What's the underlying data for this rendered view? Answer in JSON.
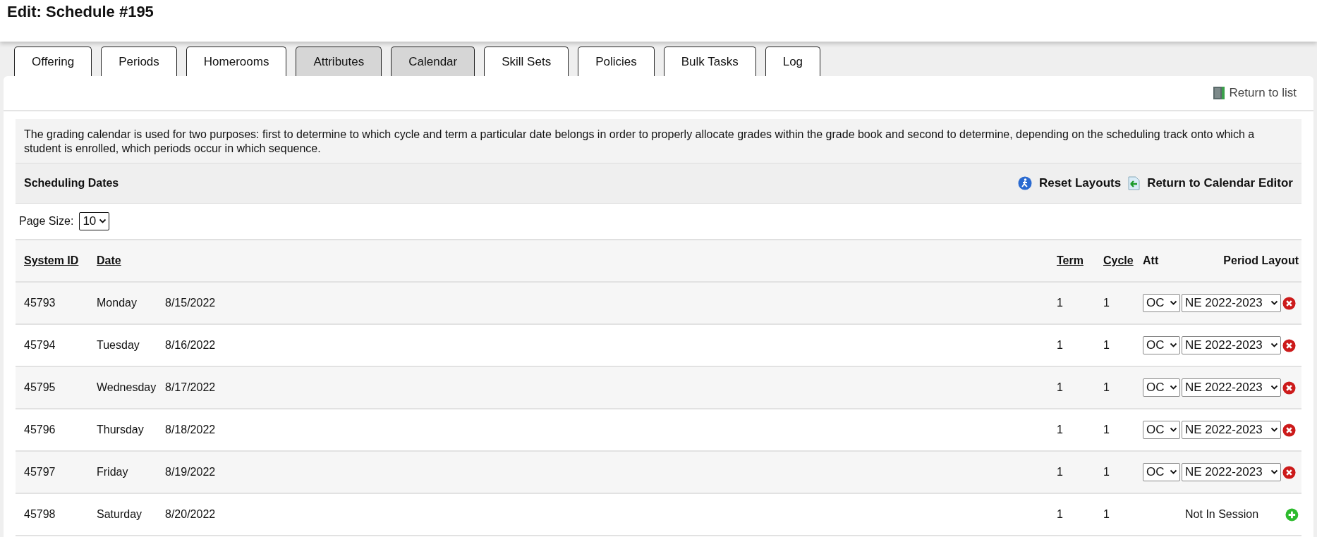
{
  "page_title": "Edit: Schedule #195",
  "tabs": [
    {
      "label": "Offering",
      "shaded": false
    },
    {
      "label": "Periods",
      "shaded": false
    },
    {
      "label": "Homerooms",
      "shaded": false
    },
    {
      "label": "Attributes",
      "shaded": true
    },
    {
      "label": "Calendar",
      "shaded": true
    },
    {
      "label": "Skill Sets",
      "shaded": false
    },
    {
      "label": "Policies",
      "shaded": false
    },
    {
      "label": "Bulk Tasks",
      "shaded": false
    },
    {
      "label": "Log",
      "shaded": false
    }
  ],
  "return_link": "Return to list",
  "description": "The grading calendar is used for two purposes: first to determine to which cycle and term a particular date belongs in order to properly allocate grades within the grade book and second to determine, depending on the scheduling track onto which a student is enrolled, which periods occur in which sequence.",
  "section": {
    "title": "Scheduling Dates",
    "actions": [
      {
        "kind": "reset",
        "label": "Reset Layouts"
      },
      {
        "kind": "back",
        "label": "Return to Calendar Editor"
      }
    ]
  },
  "page_size": {
    "label": "Page Size:",
    "value": "10"
  },
  "table": {
    "columns": [
      {
        "label": "System ID",
        "sortable": true
      },
      {
        "label": "Date",
        "sortable": true
      },
      {
        "label": "Term",
        "sortable": true
      },
      {
        "label": "Cycle",
        "sortable": true
      },
      {
        "label": "Att",
        "sortable": false
      },
      {
        "label": "Period Layout",
        "sortable": false
      }
    ],
    "rows": [
      {
        "system_id": "45793",
        "day": "Monday",
        "date": "8/15/2022",
        "term": "1",
        "cycle": "1",
        "kind": "in_session",
        "att": "OC",
        "period_layout": "NE 2022-2023"
      },
      {
        "system_id": "45794",
        "day": "Tuesday",
        "date": "8/16/2022",
        "term": "1",
        "cycle": "1",
        "kind": "in_session",
        "att": "OC",
        "period_layout": "NE 2022-2023"
      },
      {
        "system_id": "45795",
        "day": "Wednesday",
        "date": "8/17/2022",
        "term": "1",
        "cycle": "1",
        "kind": "in_session",
        "att": "OC",
        "period_layout": "NE 2022-2023"
      },
      {
        "system_id": "45796",
        "day": "Thursday",
        "date": "8/18/2022",
        "term": "1",
        "cycle": "1",
        "kind": "in_session",
        "att": "OC",
        "period_layout": "NE 2022-2023"
      },
      {
        "system_id": "45797",
        "day": "Friday",
        "date": "8/19/2022",
        "term": "1",
        "cycle": "1",
        "kind": "in_session",
        "att": "OC",
        "period_layout": "NE 2022-2023"
      },
      {
        "system_id": "45798",
        "day": "Saturday",
        "date": "8/20/2022",
        "term": "1",
        "cycle": "1",
        "kind": "not_in_session",
        "status": "Not In Session"
      }
    ]
  }
}
